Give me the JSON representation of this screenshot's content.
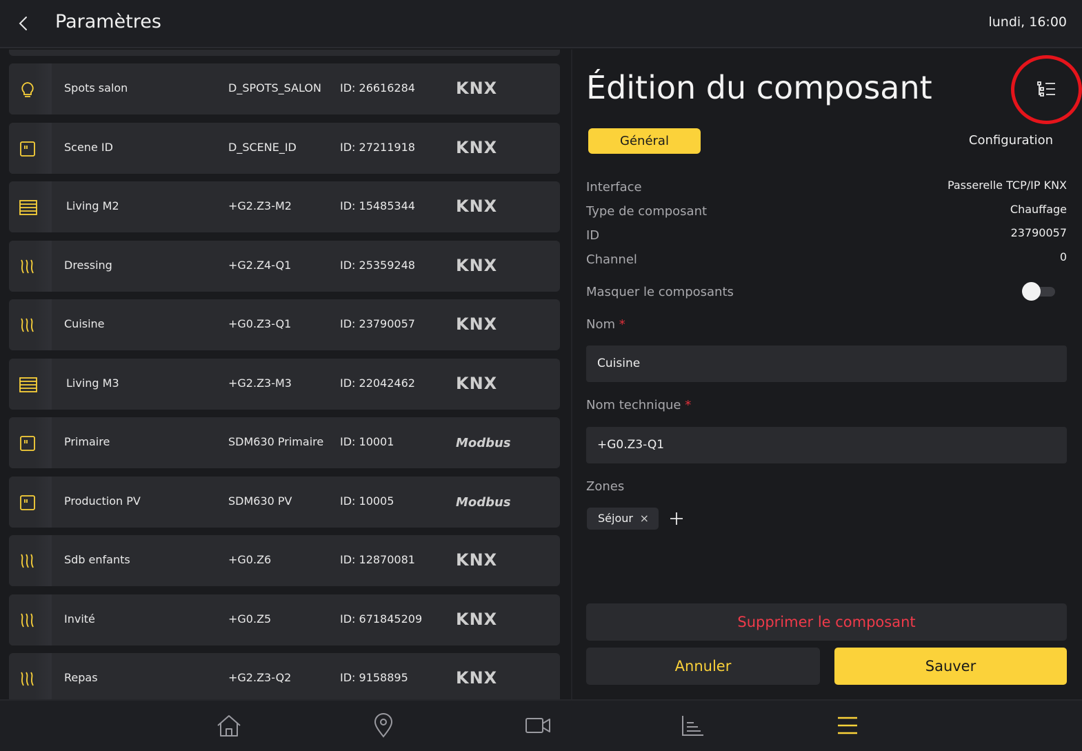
{
  "header": {
    "title": "Paramètres",
    "clock": "lundi, 16:00"
  },
  "colors": {
    "accent": "#fbd23a",
    "danger": "#ef3a4a",
    "highlight_ring": "#e5141b",
    "background": "#1a1b1e",
    "row_bg": "#2a2b2f"
  },
  "components": [
    {
      "name": "Spots salon",
      "tech": "D_SPOTS_SALON",
      "id": "ID: 26616284",
      "protocol": "KNX",
      "icon": "bulb-icon"
    },
    {
      "name": "Scene ID",
      "tech": "D_SCENE_ID",
      "id": "ID: 27211918",
      "protocol": "KNX",
      "icon": "switch-icon"
    },
    {
      "name": "Living M2",
      "tech": "+G2.Z3-M2",
      "id": "ID: 15485344",
      "protocol": "KNX",
      "icon": "blind-icon"
    },
    {
      "name": "Dressing",
      "tech": "+G2.Z4-Q1",
      "id": "ID: 25359248",
      "protocol": "KNX",
      "icon": "heating-icon"
    },
    {
      "name": "Cuisine",
      "tech": "+G0.Z3-Q1",
      "id": "ID: 23790057",
      "protocol": "KNX",
      "icon": "heating-icon"
    },
    {
      "name": "Living M3",
      "tech": "+G2.Z3-M3",
      "id": "ID: 22042462",
      "protocol": "KNX",
      "icon": "blind-icon"
    },
    {
      "name": "Primaire",
      "tech": "SDM630 Primaire",
      "id": "ID: 10001",
      "protocol": "Modbus",
      "icon": "switch-icon"
    },
    {
      "name": "Production PV",
      "tech": "SDM630 PV",
      "id": "ID: 10005",
      "protocol": "Modbus",
      "icon": "switch-icon"
    },
    {
      "name": "Sdb enfants",
      "tech": "+G0.Z6",
      "id": "ID: 12870081",
      "protocol": "KNX",
      "icon": "heating-icon"
    },
    {
      "name": "Invité",
      "tech": "+G0.Z5",
      "id": "ID: 671845209",
      "protocol": "KNX",
      "icon": "heating-icon"
    },
    {
      "name": "Repas",
      "tech": "+G2.Z3-Q2",
      "id": "ID: 9158895",
      "protocol": "KNX",
      "icon": "heating-icon"
    }
  ],
  "editor": {
    "title": "Édition du composant",
    "tabs": {
      "general": "Général",
      "configuration": "Configuration"
    },
    "info": {
      "interface_label": "Interface",
      "interface_value": "Passerelle TCP/IP KNX",
      "type_label": "Type de composant",
      "type_value": "Chauffage",
      "id_label": "ID",
      "id_value": "23790057",
      "channel_label": "Channel",
      "channel_value": "0"
    },
    "hide_label": "Masquer le composants",
    "hide_enabled": false,
    "name_label": "Nom",
    "name_value": "Cuisine",
    "tech_label": "Nom technique",
    "tech_value": "+G0.Z3-Q1",
    "required_mark": "*",
    "zones_label": "Zones",
    "zones": [
      "Séjour"
    ],
    "chip_remove": "×",
    "delete_label": "Supprimer le composant",
    "cancel_label": "Annuler",
    "save_label": "Sauver"
  },
  "nav": [
    "home-icon",
    "location-icon",
    "camera-icon",
    "chart-icon",
    "menu-icon"
  ],
  "nav_active": "menu-icon"
}
